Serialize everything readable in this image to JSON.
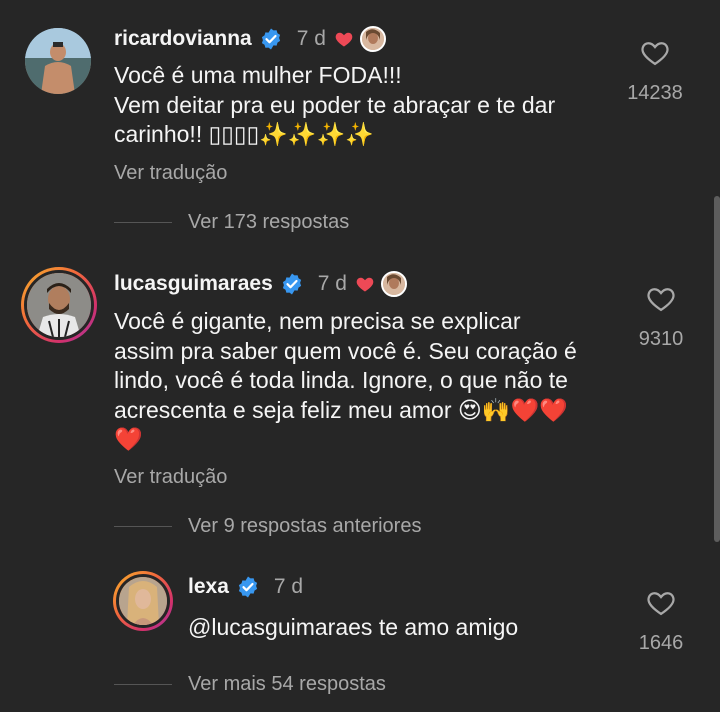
{
  "comments": [
    {
      "username": "ricardovianna",
      "time": "7 d",
      "text_lines": [
        "Você é uma mulher FODA!!!",
        "Vem deitar pra eu poder te abraçar e te dar",
        "carinho!! ▯▯▯▯✨✨✨✨"
      ],
      "translate": "Ver tradução",
      "likes": "14238",
      "replies": "Ver 173 respostas"
    },
    {
      "username": "lucasguimaraes",
      "time": "7 d",
      "text_lines": [
        "Você é gigante, nem precisa se explicar",
        "assim pra saber quem você é. Seu coração é",
        "lindo, você é toda linda. Ignore, o que não te",
        "acrescenta e seja feliz meu amor 😍🙌❤️❤️",
        "❤️"
      ],
      "translate": "Ver tradução",
      "likes": "9310",
      "replies": "Ver 9 respostas anteriores"
    }
  ],
  "reply": {
    "username": "lexa",
    "time": "7 d",
    "text": "@lucasguimaraes te amo amigo",
    "likes": "1646",
    "more_replies": "Ver mais 54 respostas"
  },
  "colors": {
    "background": "#262626",
    "verified": "#3897f0",
    "heart": "#ed4956",
    "secondary_text": "#a8a8a8"
  },
  "icons": [
    "verified-badge-icon",
    "heart-icon",
    "heart-outline-icon"
  ]
}
